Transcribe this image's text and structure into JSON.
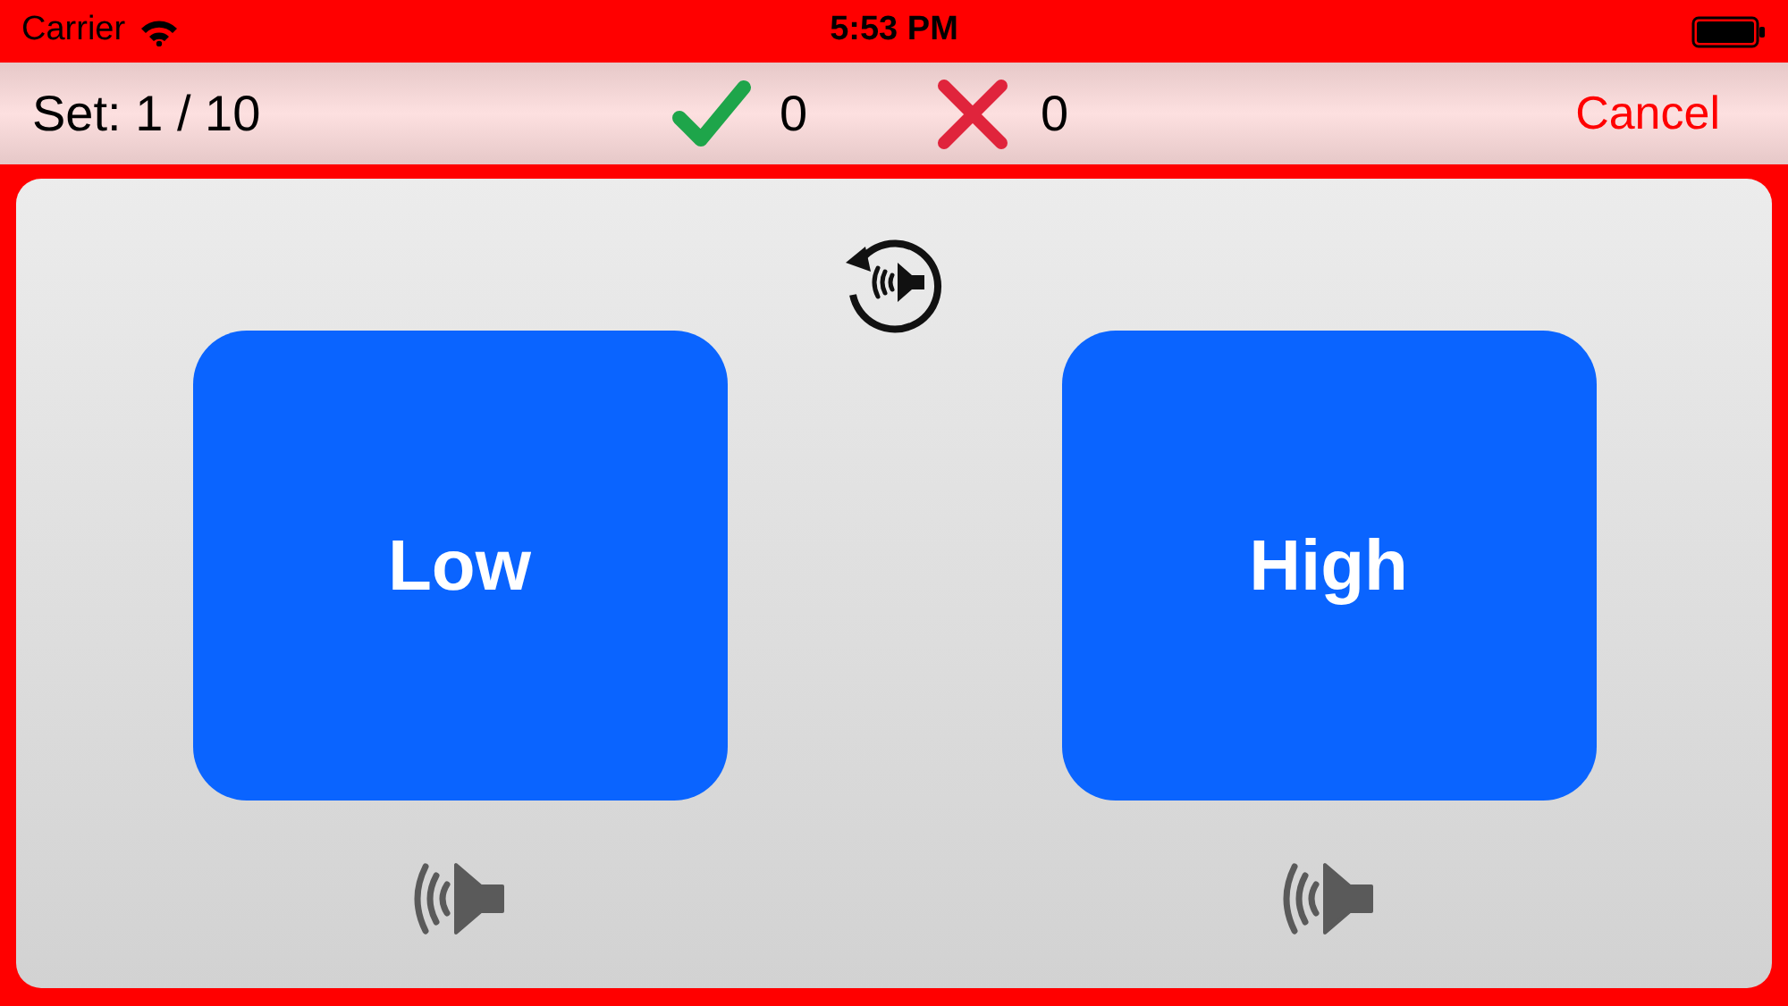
{
  "status_bar": {
    "carrier": "Carrier",
    "time": "5:53 PM"
  },
  "toolbar": {
    "set": "Set: 1 / 10",
    "correct": "0",
    "wrong": "0",
    "cancel": "Cancel"
  },
  "choices": [
    {
      "label": "Low"
    },
    {
      "label": "High"
    }
  ]
}
